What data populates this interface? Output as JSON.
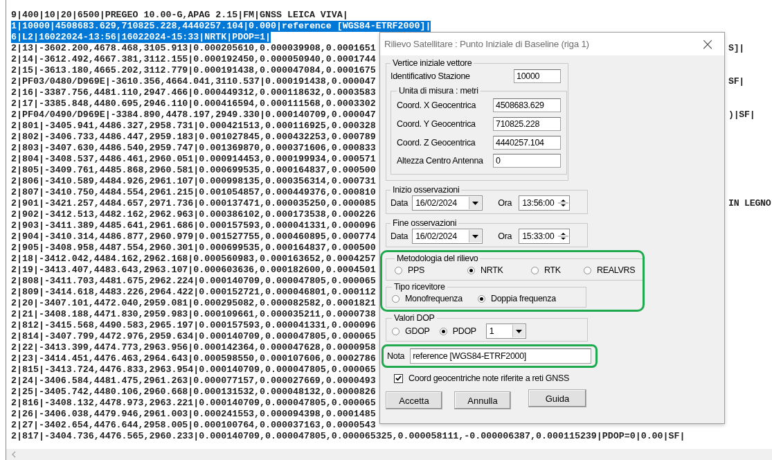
{
  "editor": {
    "lines": [
      {
        "text": "9|400|10|20|6500|PREGEO 10.00-G,APAG 2.15|FM|GNSS LEICA VIVA|",
        "selected": false
      },
      {
        "text": "1|10000|4508683.629,710825.228,4440257.104|0.000|reference [WGS84-ETRF2000]|",
        "selected": true
      },
      {
        "text": "6|L2|16022024-13:56|16022024-15:33|NRTK|PDOP=1|",
        "selected": true
      },
      {
        "text": "2|13|-3602.200,4678.468,3105.913|0.000205610,0.000039908,0.0001651",
        "selected": false,
        "tail": "S]|"
      },
      {
        "text": "2|14|-3612.492,4667.381,3112.155|0.000192450,0.000050940,0.0001744",
        "selected": false
      },
      {
        "text": "2|15|-3613.180,4665.202,3112.779|0.000191438,0.000047084,0.0001675",
        "selected": false
      },
      {
        "text": "2|PF03/0480/D969E|-3610.356,4664.041,3110.537|0.000191438,0.000047",
        "selected": false,
        "tail": "SF|"
      },
      {
        "text": "2|16|-3387.756,4481.110,2947.466|0.000449312,0.000118632,0.0003583",
        "selected": false
      },
      {
        "text": "2|17|-3385.848,4480.695,2946.110|0.000416594,0.000111568,0.0003302",
        "selected": false
      },
      {
        "text": "2|PF04/0490/D969E|-3384.890,4478.197,2949.330|0.000140709,0.000047",
        "selected": false,
        "tail": ")|SF|"
      },
      {
        "text": "2|801|-3405.941,4486.327,2958.731|0.000421513,0.000116925,0.000328",
        "selected": false
      },
      {
        "text": "2|802|-3406.733,4486.447,2959.183|0.001027845,0.000432253,0.000789",
        "selected": false
      },
      {
        "text": "2|803|-3407.630,4486.540,2959.747|0.001369870,0.000371606,0.000833",
        "selected": false
      },
      {
        "text": "2|804|-3408.537,4486.461,2960.051|0.000914453,0.000199934,0.000571",
        "selected": false
      },
      {
        "text": "2|805|-3409.761,4485.868,2960.581|0.000699535,0.000164837,0.000500",
        "selected": false
      },
      {
        "text": "2|806|-3410.589,4484.926,2961.107|0.000998135,0.000356314,0.000731",
        "selected": false
      },
      {
        "text": "2|807|-3410.750,4484.554,2961.215|0.001054857,0.000449376,0.000810",
        "selected": false
      },
      {
        "text": "2|901|-3421.257,4484.657,2971.736|0.000137471,0.000035250,0.000085",
        "selected": false,
        "tail": "IN LEGNO"
      },
      {
        "text": "2|902|-3412.513,4482.162,2962.963|0.000386102,0.000173538,0.000226",
        "selected": false
      },
      {
        "text": "2|903|-3411.389,4485.641,2961.686|0.000157593,0.000041331,0.000096",
        "selected": false
      },
      {
        "text": "2|904|-3410.314,4486.877,2960.979|0.001527755,0.000460895,0.000774",
        "selected": false
      },
      {
        "text": "2|905|-3408.958,4487.554,2960.301|0.000699535,0.000164837,0.000500",
        "selected": false
      },
      {
        "text": "2|18|-3412.042,4484.162,2962.168|0.000560983,0.000163652,0.0004257",
        "selected": false
      },
      {
        "text": "2|19|-3413.407,4483.643,2963.107|0.000603636,0.000182600,0.0004501",
        "selected": false
      },
      {
        "text": "2|808|-3411.703,4481.675,2962.224|0.000140709,0.000047805,0.000065",
        "selected": false
      },
      {
        "text": "2|809|-3414.618,4483.226,2964.422|0.000152721,0.000046801,0.000112",
        "selected": false
      },
      {
        "text": "2|20|-3407.101,4472.040,2959.081|0.000295082,0.000082582,0.0001821",
        "selected": false
      },
      {
        "text": "2|21|-3408.188,4471.830,2959.983|0.000109661,0.000035211,0.0000738",
        "selected": false
      },
      {
        "text": "2|812|-3415.568,4490.583,2965.197|0.000157593,0.000041331,0.000096",
        "selected": false
      },
      {
        "text": "2|814|-3407.799,4472.976,2959.634|0.000140709,0.000047805,0.000065",
        "selected": false
      },
      {
        "text": "2|22|-3413.399,4474.773,2963.956|0.000142364,0.000047628,0.0000958",
        "selected": false
      },
      {
        "text": "2|23|-3414.451,4476.463,2964.643|0.000598550,0.000107606,0.0002786",
        "selected": false
      },
      {
        "text": "2|815|-3413.724,4476.833,2963.954|0.000140709,0.000047805,0.000065",
        "selected": false
      },
      {
        "text": "2|24|-3406.584,4481.475,2961.263|0.000077157,0.000027669,0.0000493",
        "selected": false
      },
      {
        "text": "2|25|-3405.742,4480.106,2960.668|0.000131532,0.000048132,0.0000826",
        "selected": false
      },
      {
        "text": "2|816|-3408.132,4478.973,2963.221|0.000140709,0.000047805,0.000065",
        "selected": false
      },
      {
        "text": "2|26|-3406.038,4479.946,2961.003|0.000241553,0.000094398,0.0001485",
        "selected": false
      },
      {
        "text": "2|27|-3402.654,4476.644,2958.005|0.000100764,0.000037163,0.0000543",
        "selected": false
      },
      {
        "text": "2|817|-3404.736,4476.565,2960.233|0.000140709,0.000047805,0.000065325,0.000058111,-0.000006387,0.000115239|PDOP=0|0.00|SF|",
        "selected": false
      }
    ]
  },
  "dialog": {
    "title": "Rilievo Satellitare : Punto Iniziale di Baseline (riga 1)",
    "close": "×",
    "vertex": {
      "legend": "Vertice iniziale vettore",
      "station_label": "Identificativo Stazione",
      "station_value": "10000",
      "units": {
        "legend": "Unita di misura : metri",
        "fields": [
          {
            "label": "Coord. X Geocentrica",
            "value": "4508683.629"
          },
          {
            "label": "Coord. Y Geocentrica",
            "value": "710825.228"
          },
          {
            "label": "Coord. Z Geocentrica",
            "value": "4440257.104"
          },
          {
            "label": "Altezza Centro Antenna",
            "value": "0"
          }
        ]
      }
    },
    "start": {
      "legend": "Inizio osservazioni",
      "date_label": "Data",
      "date": "16/02/2024",
      "time_label": "Ora",
      "time": "13:56:00"
    },
    "end": {
      "legend": "Fine osservazioni",
      "date_label": "Data",
      "date": "16/02/2024",
      "time_label": "Ora",
      "time": "15:33:00"
    },
    "survey_block": {
      "outlined": true,
      "method": {
        "legend": "Metodologia del rilievo",
        "options": [
          {
            "label": "PPS",
            "selected": false
          },
          {
            "label": "NRTK",
            "selected": true
          },
          {
            "label": "RTK",
            "selected": false
          },
          {
            "label": "REALVRS",
            "selected": false
          }
        ]
      },
      "receiver": {
        "legend": "Tipo ricevitore",
        "options": [
          {
            "label": "Monofrequenza",
            "selected": false
          },
          {
            "label": "Doppia frequenza",
            "selected": true
          }
        ]
      }
    },
    "dop": {
      "legend": "Valori DOP",
      "options": [
        {
          "label": "GDOP",
          "selected": false
        },
        {
          "label": "PDOP",
          "selected": true
        }
      ],
      "value": "1"
    },
    "note": {
      "label": "Nota",
      "value": "reference [WGS84-ETRF2000]",
      "outlined": true
    },
    "gnss_checkbox": {
      "label": "Coord geocentriche note riferite a reti GNSS",
      "checked": true
    },
    "buttons": [
      "Accetta",
      "Annulla",
      "Guida"
    ]
  }
}
